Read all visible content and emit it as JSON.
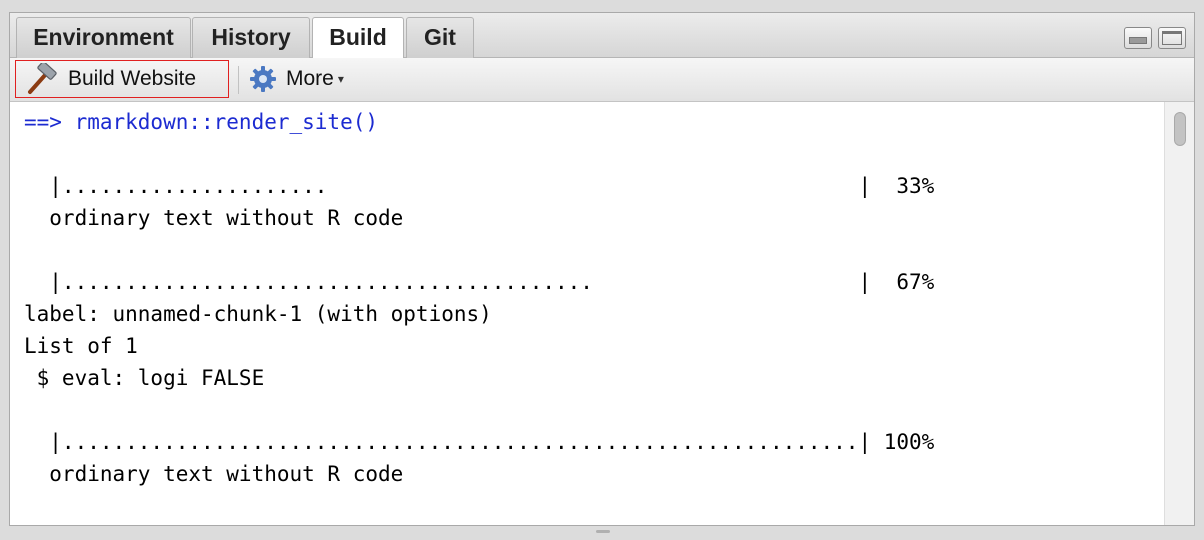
{
  "tabs": [
    {
      "label": "Environment",
      "active": false
    },
    {
      "label": "History",
      "active": false
    },
    {
      "label": "Build",
      "active": true
    },
    {
      "label": "Git",
      "active": false
    }
  ],
  "toolbar": {
    "build_label": "Build Website",
    "build_icon": "hammer-icon",
    "more_label": "More",
    "more_icon": "gear-icon",
    "more_caret": "▾",
    "build_highlight_color": "#e02020"
  },
  "console": {
    "command_color": "#1c2bd1",
    "lines": [
      "==> rmarkdown::render_site()",
      "",
      "  |.....................                                          |  33%",
      "  ordinary text without R code",
      "",
      "  |..........................................                     |  67%",
      "label: unnamed-chunk-1 (with options)",
      "List of 1",
      " $ eval: logi FALSE",
      "",
      "  |...............................................................| 100%",
      "  ordinary text without R code"
    ]
  }
}
